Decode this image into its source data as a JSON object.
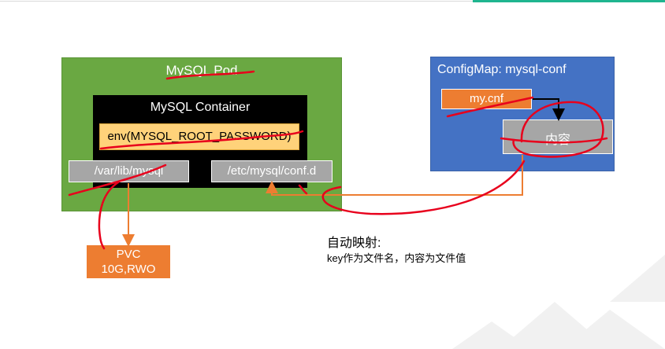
{
  "pod": {
    "title": "MySQL Pod"
  },
  "container": {
    "title": "MySQL Container",
    "env": "env(MYSQL_ROOT_PASSWORD)"
  },
  "mounts": {
    "data_path": "/var/lib/mysql",
    "conf_path": "/etc/mysql/conf.d"
  },
  "pvc": {
    "line1": "PVC",
    "line2": "10G,RWO"
  },
  "configmap": {
    "title": "ConfigMap: mysql-conf",
    "key": "my.cnf",
    "value": "内容"
  },
  "note": {
    "title": "自动映射:",
    "text": "key作为文件名，内容为文件值"
  },
  "colors": {
    "pod_green": "#6aa842",
    "configmap_blue": "#4472c4",
    "orange": "#ed7d31",
    "annotation_red": "#e8001c",
    "gray_box": "#a6a6a6",
    "env_yellow": "#ffd27a"
  }
}
